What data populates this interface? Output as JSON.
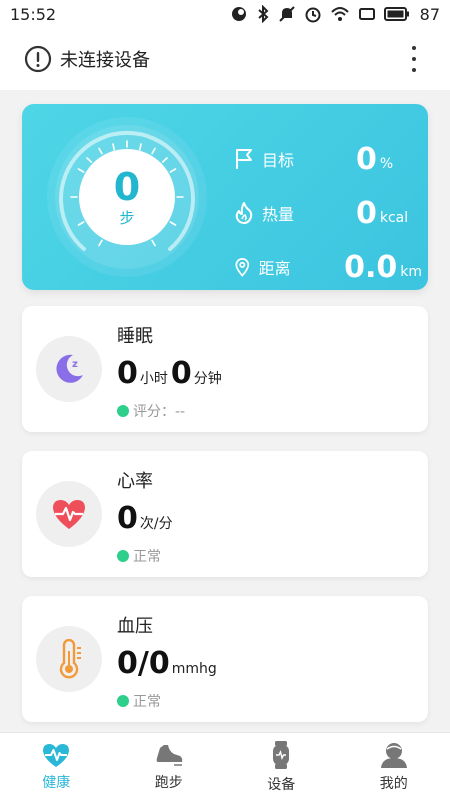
{
  "status_bar": {
    "time": "15:52",
    "battery": "87"
  },
  "header": {
    "title": "未连接设备"
  },
  "steps": {
    "value": "0",
    "unit": "步",
    "stats": [
      {
        "label": "目标",
        "value": "0",
        "unit": "%"
      },
      {
        "label": "热量",
        "value": "0",
        "unit": "kcal"
      },
      {
        "label": "距离",
        "value": "0.0",
        "unit": "km"
      }
    ]
  },
  "cards": {
    "sleep": {
      "title": "睡眠",
      "hours": "0",
      "hours_unit": "小时",
      "minutes": "0",
      "minutes_unit": "分钟",
      "status": "评分：--"
    },
    "heart": {
      "title": "心率",
      "value": "0",
      "unit": "次/分",
      "status": "正常"
    },
    "pressure": {
      "title": "血压",
      "value": "0/0",
      "unit": "mmhg",
      "status": "正常"
    }
  },
  "nav": {
    "items": [
      {
        "label": "健康"
      },
      {
        "label": "跑步"
      },
      {
        "label": "设备"
      },
      {
        "label": "我的"
      }
    ]
  },
  "colors": {
    "accent": "#2bb7d8",
    "card_gradient_start": "#4ed6e6",
    "status_ok": "#2ecf8a",
    "heart": "#ef4f5a",
    "moon": "#8a6ee8",
    "thermometer": "#f29a3a"
  }
}
